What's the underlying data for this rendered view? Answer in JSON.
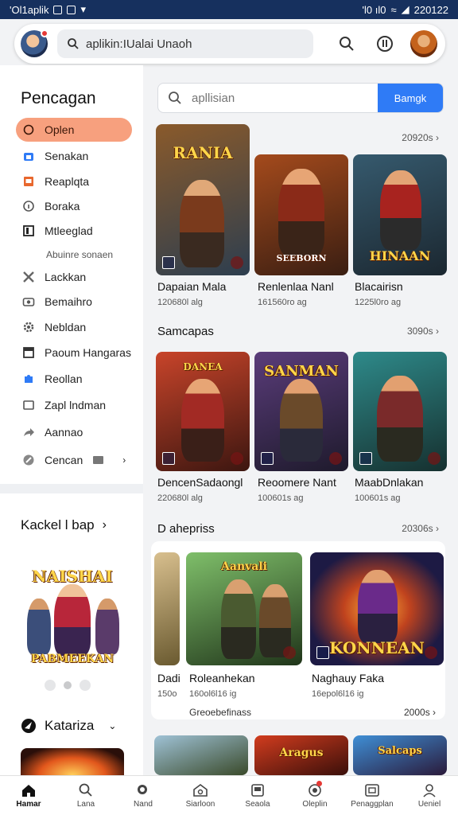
{
  "status_bar": {
    "left_text": "'Ol1aplik",
    "right_text": "'l0 ıl0",
    "time": "220122"
  },
  "top_search": {
    "query": "aplikin:IUalai Unaoh"
  },
  "sidebar": {
    "title": "Pencagan",
    "items": [
      {
        "label": "Oplen",
        "icon": "circle-icon",
        "active": true
      },
      {
        "label": "Senakan",
        "icon": "bag-icon"
      },
      {
        "label": "Reaplqta",
        "icon": "box-icon"
      },
      {
        "label": "Boraka",
        "icon": "info-icon"
      },
      {
        "label": "Mtleeglad",
        "icon": "bookmark-icon"
      },
      {
        "label": "Lackkan",
        "icon": "cross-icon"
      },
      {
        "label": "Bemaihro",
        "icon": "camera-icon"
      },
      {
        "label": "Nebldan",
        "icon": "gear-icon"
      },
      {
        "label": "Paoum Hangaras",
        "icon": "square-icon"
      },
      {
        "label": "Reollan",
        "icon": "puzzle-icon"
      },
      {
        "label": "Zapl lndman",
        "icon": "window-icon"
      },
      {
        "label": "Aannao",
        "icon": "share-icon"
      },
      {
        "label": "Cencan",
        "icon": "wrench-icon"
      }
    ],
    "subheading": "Abuinre sonaen",
    "section2_title": "Kackel l bap",
    "section3_title": "Katariza",
    "promo_art_text": "NAISHAI",
    "promo_art_sub": "PABMEEKAN"
  },
  "main": {
    "search_placeholder": "apllisian",
    "search_button": "Bamgk",
    "section1": {
      "more": "20920s",
      "cards": [
        {
          "title": "Dapaian Mala",
          "meta": "120680l alg",
          "art": "RANIA",
          "palette": [
            "#8a5a2b",
            "#2d3e4f"
          ]
        },
        {
          "title": "Renlenlaa Nanl",
          "meta": "161560ro ag",
          "art": "SEEBORN",
          "palette": [
            "#a44a1c",
            "#3a1e12"
          ]
        },
        {
          "title": "Blacairisn",
          "meta": "1225l0ro ag",
          "art": "HINAAN",
          "palette": [
            "#365a6e",
            "#1b2730"
          ]
        }
      ]
    },
    "section2": {
      "title": "Samcapas",
      "more": "3090s",
      "cards": [
        {
          "title": "DencenSadaongl",
          "meta": "220680l alg",
          "art": "DANEA",
          "palette": [
            "#c8442a",
            "#3c1610"
          ]
        },
        {
          "title": "Reoomere Nant",
          "meta": "100601s ag",
          "art": "SANMAN",
          "palette": [
            "#5a3c7a",
            "#1e1a2c"
          ]
        },
        {
          "title": "MaabDnlakan",
          "meta": "100601s ag",
          "art": "",
          "palette": [
            "#2e8a8a",
            "#16302f"
          ]
        }
      ]
    },
    "section3": {
      "title": "D ahepriss",
      "more": "20306s",
      "cards": [
        {
          "title": "Dadi",
          "meta": "150o",
          "art": "",
          "palette": [
            "#b89464",
            "#4a3a20"
          ]
        },
        {
          "title": "Roleanhekan",
          "meta": "160ol6l16 ig",
          "art": "Aanvali",
          "palette": [
            "#4b8a3c",
            "#20351a"
          ]
        },
        {
          "title": "Naghauy Faka",
          "meta": "16epol6l16 ig",
          "art": "KONNEAN",
          "palette": [
            "#c0431e",
            "#1d1a44"
          ]
        }
      ],
      "footer_left": "Greoebefinass",
      "footer_right": "2000s"
    },
    "section4_art": [
      "",
      "Aragus",
      "Salcaps"
    ]
  },
  "bottom_nav": [
    {
      "label": "Hamar",
      "icon": "home-icon",
      "active": true
    },
    {
      "label": "Lana",
      "icon": "search-icon"
    },
    {
      "label": "Nand",
      "icon": "magnifier-icon"
    },
    {
      "label": "Siarloon",
      "icon": "store-icon"
    },
    {
      "label": "Seaola",
      "icon": "game-icon"
    },
    {
      "label": "Oleplin",
      "icon": "chat-icon"
    },
    {
      "label": "Penaggplan",
      "icon": "apps-icon"
    },
    {
      "label": "Ueniel",
      "icon": "profile-icon"
    }
  ],
  "colors": {
    "accent": "#2f7bf6",
    "active_pill": "#f7a07e",
    "status_bar": "#16305e"
  }
}
